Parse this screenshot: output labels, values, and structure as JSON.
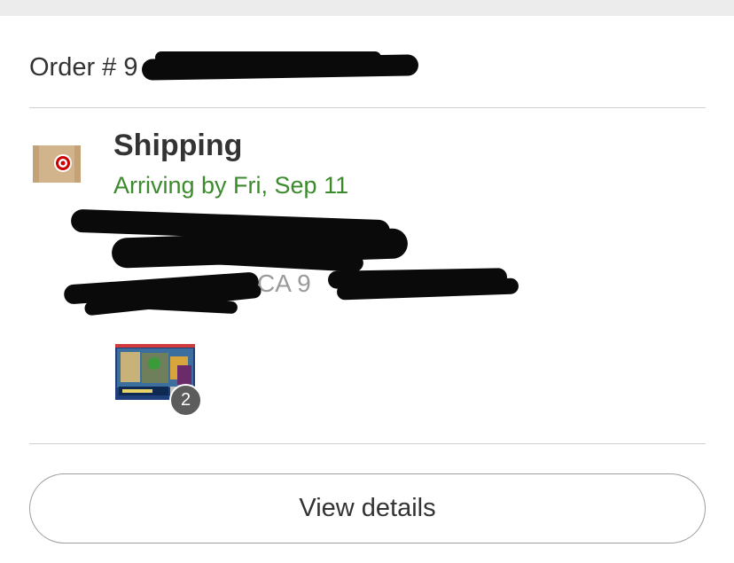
{
  "order": {
    "label": "Order #",
    "number_visible": "9"
  },
  "shipment": {
    "title": "Shipping",
    "arrival": "Arriving by Fri, Sep 11",
    "address_partial": "CA 9"
  },
  "product": {
    "quantity": "2"
  },
  "actions": {
    "view_details": "View details"
  },
  "colors": {
    "arrival_green": "#3b8b2c",
    "target_red": "#cc0000",
    "box_tan": "#d2b48c"
  }
}
